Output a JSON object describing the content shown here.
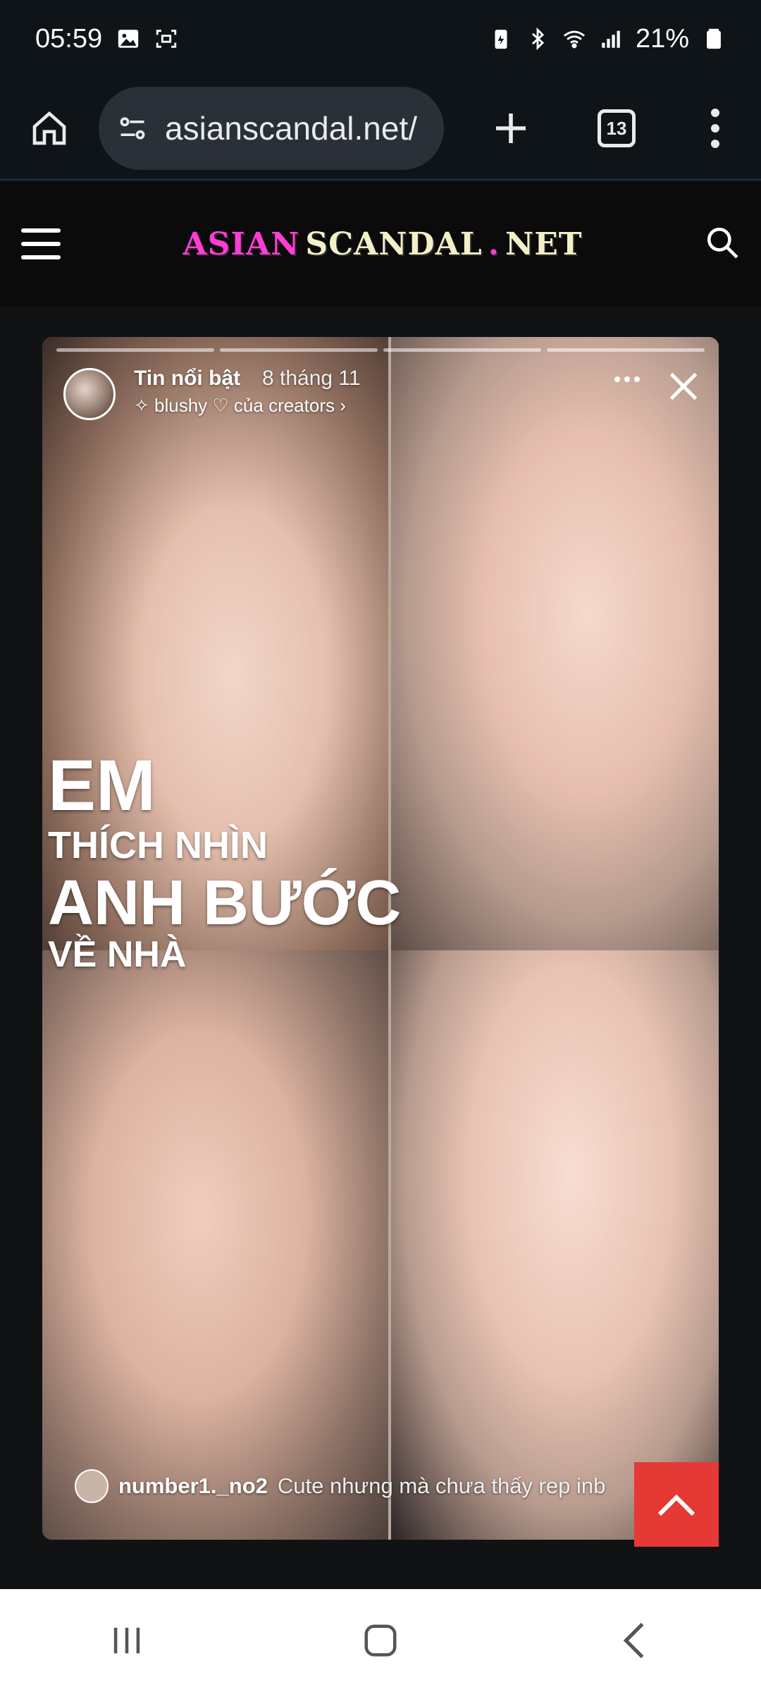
{
  "status_bar": {
    "time": "05:59",
    "battery": "21%",
    "icons": [
      "gallery-icon",
      "screenshot-icon",
      "battery-saver-icon",
      "bluetooth-icon",
      "wifi-icon",
      "signal-icon",
      "battery-icon"
    ]
  },
  "browser": {
    "url": "asianscandal.net/",
    "tab_count": "13"
  },
  "site": {
    "logo_part1": "ASIAN",
    "logo_part2": "SCANDAL",
    "logo_dot": ".",
    "logo_part3": "NET"
  },
  "story": {
    "title": "Tin nổi bật",
    "date": "8 tháng 11",
    "subtitle": "✧ blushy ♡ của creators ›",
    "overlay_line1": "EM",
    "overlay_line2": "THÍCH NHÌN",
    "overlay_line3": "ANH BƯỚC",
    "overlay_line4": "VỀ NHÀ",
    "comment_user": "number1._no2",
    "comment_text": "Cute nhưng mà chưa thấy rep inb"
  },
  "colors": {
    "accent_pink": "#ff3dd4",
    "scroll_top_red": "#e53935"
  }
}
